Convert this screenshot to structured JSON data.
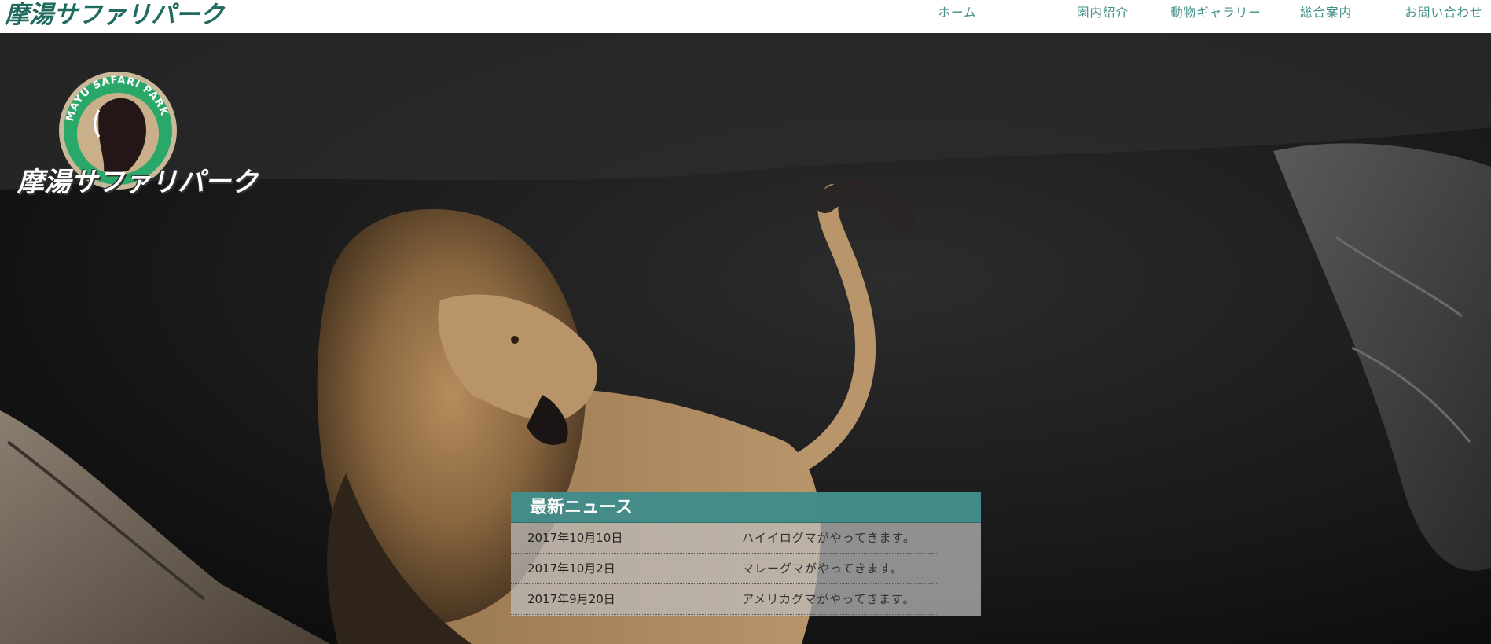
{
  "header": {
    "brand": "摩湯サファリパーク",
    "nav": [
      {
        "label": "ホーム"
      },
      {
        "label": "園内紹介"
      },
      {
        "label": "動物ギャラリー"
      },
      {
        "label": "総合案内"
      },
      {
        "label": "お問い合わせ"
      }
    ]
  },
  "hero": {
    "logo_ring_text": "MAYU SAFARI PARK",
    "logo_text": "摩湯サファリパーク"
  },
  "news": {
    "title": "最新ニュース",
    "items": [
      {
        "date": "2017年10月10日",
        "title": "ハイイログマがやってきます。"
      },
      {
        "date": "2017年10月2日",
        "title": "マレーグマがやってきます。"
      },
      {
        "date": "2017年9月20日",
        "title": "アメリカグマがやってきます。"
      }
    ]
  },
  "colors": {
    "brand": "#1f6b5f",
    "nav_text": "#3f8e88",
    "news_header": "#3f8b87",
    "logo_ring": "#2aa86a"
  }
}
